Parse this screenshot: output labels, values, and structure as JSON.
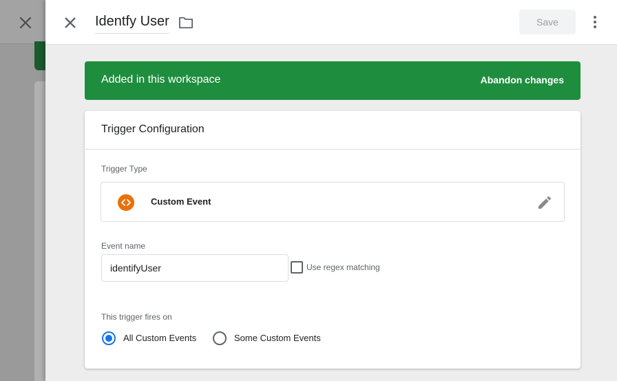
{
  "header": {
    "title": "Identfy User",
    "save_label": "Save"
  },
  "banner": {
    "text": "Added in this workspace",
    "action": "Abandon changes",
    "color": "#1e8e3e"
  },
  "card": {
    "title": "Trigger Configuration",
    "trigger_type_label": "Trigger Type",
    "trigger_type_name": "Custom Event",
    "trigger_icon_color": "#e8710a",
    "event_name_label": "Event name",
    "event_name_value": "identifyUser",
    "regex_label": "Use regex matching",
    "regex_checked": false,
    "fires_on_label": "This trigger fires on",
    "fires_options": [
      {
        "label": "All Custom Events",
        "selected": true
      },
      {
        "label": "Some Custom Events",
        "selected": false
      }
    ]
  },
  "icons": {
    "close": "close-icon",
    "folder": "folder-icon",
    "more": "more-vert-icon",
    "trigger_type": "code-brackets-icon",
    "edit": "pencil-icon"
  },
  "colors": {
    "accent": "#1a73e8",
    "banner_green": "#1e8e3e",
    "custom_event_orange": "#e8710a"
  }
}
